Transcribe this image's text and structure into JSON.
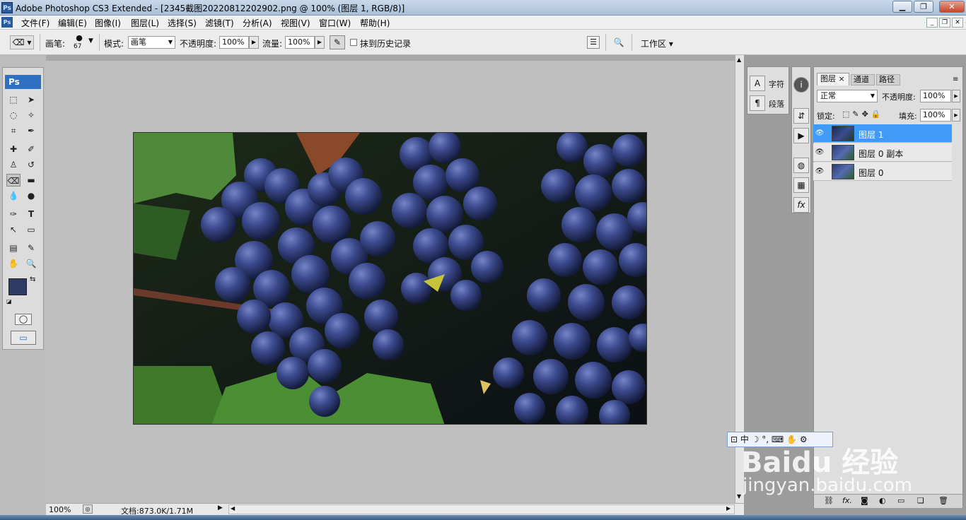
{
  "app": {
    "window_title": "Adobe Photoshop CS3 Extended - [2345截图20220812202902.png @ 100% (图层 1, RGB/8)]",
    "ps_badge": "Ps"
  },
  "menu": {
    "items": [
      "文件(F)",
      "编辑(E)",
      "图像(I)",
      "图层(L)",
      "选择(S)",
      "滤镜(T)",
      "分析(A)",
      "视图(V)",
      "窗口(W)",
      "帮助(H)"
    ]
  },
  "options": {
    "brush_label": "画笔:",
    "brush_size": "67",
    "mode_label": "模式:",
    "mode_value": "画笔",
    "opacity_label": "不透明度:",
    "opacity_value": "100%",
    "flow_label": "流量:",
    "flow_value": "100%",
    "history_label": "抹到历史记录",
    "workspace_label": "工作区"
  },
  "toolbox": {
    "header": "Ps"
  },
  "status": {
    "zoom": "100%",
    "doc_info": "文档:873.0K/1.71M"
  },
  "char_panel": {
    "char_label": "字符",
    "para_label": "段落"
  },
  "layers_panel": {
    "tabs": [
      "图层",
      "通道",
      "路径"
    ],
    "blend_mode": "正常",
    "opacity_label": "不透明度:",
    "opacity_value": "100%",
    "lock_label": "锁定:",
    "fill_label": "填充:",
    "fill_value": "100%",
    "layers": [
      {
        "name": "图层 1",
        "selected": true
      },
      {
        "name": "图层 0 副本",
        "selected": false
      },
      {
        "name": "图层 0",
        "selected": false
      }
    ]
  },
  "ime_bar": {
    "mode": "中"
  },
  "watermark": {
    "brand": "Baidu 经验",
    "url": "jingyan.baidu.com"
  },
  "colors": {
    "foreground": "#2d3a63",
    "background": "#ffffff",
    "selection": "#3f9bf5"
  }
}
